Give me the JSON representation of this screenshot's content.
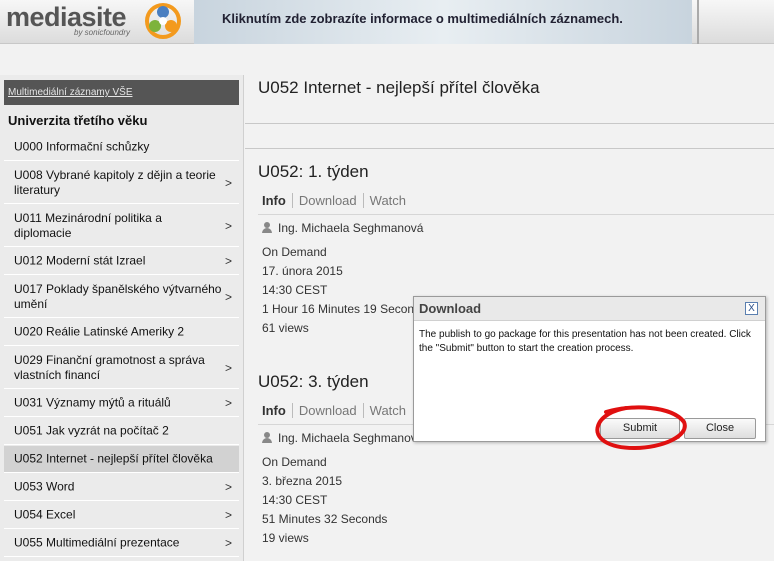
{
  "header": {
    "logo_text": "mediasite",
    "logo_sub": "by sonicfoundry",
    "banner_text": "Kliknutím zde zobrazíte informace o multimediálních záznamech."
  },
  "sidebar": {
    "top_link": "Multimediální záznamy VŠE",
    "heading": "Univerzita třetího věku",
    "items": [
      {
        "label": "U000 Informační schůzky",
        "chevron": ""
      },
      {
        "label": "U008 Vybrané kapitoly z dějin a teorie literatury",
        "chevron": ">"
      },
      {
        "label": "U011 Mezinárodní politika a diplomacie",
        "chevron": ">"
      },
      {
        "label": "U012 Moderní stát Izrael",
        "chevron": ">"
      },
      {
        "label": "U017 Poklady španělského výtvarného umění",
        "chevron": ">"
      },
      {
        "label": "U020 Reálie Latinské Ameriky 2",
        "chevron": ""
      },
      {
        "label": "U029 Finanční gramotnost a správa vlastních financí",
        "chevron": ">"
      },
      {
        "label": "U031 Významy mýtů a rituálů",
        "chevron": ">"
      },
      {
        "label": "U051 Jak vyzrát na počítač 2",
        "chevron": ""
      },
      {
        "label": "U052 Internet - nejlepší přítel člověka",
        "chevron": ""
      },
      {
        "label": "U053 Word",
        "chevron": ">"
      },
      {
        "label": "U054 Excel",
        "chevron": ">"
      },
      {
        "label": "U055 Multimediální prezentace",
        "chevron": ">"
      }
    ]
  },
  "main": {
    "title": "U052 Internet - nejlepší přítel člověka",
    "presentations": [
      {
        "title": "U052: 1. týden",
        "tabs": [
          "Info",
          "Download",
          "Watch"
        ],
        "presenter": "Ing. Michaela Seghmanová",
        "availability": "On Demand",
        "date": "17. února 2015",
        "time": "14:30 CEST",
        "duration": "1 Hour 16 Minutes 19 Seconds",
        "views": "61 views"
      },
      {
        "title": "U052: 3. týden",
        "tabs": [
          "Info",
          "Download",
          "Watch"
        ],
        "presenter": "Ing. Michaela Seghmanová",
        "availability": "On Demand",
        "date": "3. března 2015",
        "time": "14:30 CEST",
        "duration": "51 Minutes 32 Seconds",
        "views": "19 views"
      }
    ]
  },
  "dialog": {
    "title": "Download",
    "close_glyph": "X",
    "message": "The publish to go package for this presentation has not been created. Click the \"Submit\" button to start the creation process.",
    "submit_label": "Submit",
    "close_label": "Close"
  }
}
